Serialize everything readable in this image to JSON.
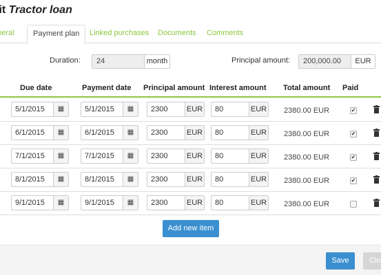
{
  "header": {
    "title_prefix": "lit ",
    "title_name": "Tractor loan"
  },
  "tabs": [
    {
      "label": "eneral",
      "active": false
    },
    {
      "label": "Payment plan",
      "active": true
    },
    {
      "label": "Linked purchases",
      "active": false
    },
    {
      "label": "Documents",
      "active": false
    },
    {
      "label": "Comments",
      "active": false
    }
  ],
  "summary": {
    "duration_label": "Duration:",
    "duration_value": "24",
    "duration_unit": "month",
    "principal_label": "Principal amount:",
    "principal_value": "200,000.00",
    "principal_currency": "EUR"
  },
  "table": {
    "columns": [
      "Due date",
      "Payment date",
      "Principal amount",
      "Interest amount",
      "Total amount",
      "Paid"
    ],
    "rows": [
      {
        "due_date": "5/1/2015",
        "payment_date": "5/1/2015",
        "principal": "2300",
        "principal_cur": "EUR",
        "interest": "80",
        "interest_cur": "EUR",
        "total": "2380.00 EUR",
        "paid_mark": "✔"
      },
      {
        "due_date": "6/1/2015",
        "payment_date": "6/1/2015",
        "principal": "2300",
        "principal_cur": "EUR",
        "interest": "80",
        "interest_cur": "EUR",
        "total": "2380.00 EUR",
        "paid_mark": "✔"
      },
      {
        "due_date": "7/1/2015",
        "payment_date": "7/1/2015",
        "principal": "2300",
        "principal_cur": "EUR",
        "interest": "80",
        "interest_cur": "EUR",
        "total": "2380.00 EUR",
        "paid_mark": "✔"
      },
      {
        "due_date": "8/1/2015",
        "payment_date": "8/1/2015",
        "principal": "2300",
        "principal_cur": "EUR",
        "interest": "80",
        "interest_cur": "EUR",
        "total": "2380.00 EUR",
        "paid_mark": "✔"
      },
      {
        "due_date": "9/1/2015",
        "payment_date": "9/1/2015",
        "principal": "2300",
        "principal_cur": "EUR",
        "interest": "80",
        "interest_cur": "EUR",
        "total": "2380.00 EUR",
        "paid_mark": ""
      }
    ]
  },
  "actions": {
    "add_label": "Add new item",
    "save_label": "Save",
    "close_label": "Clo"
  },
  "icons": {
    "calendar": "calendar-icon",
    "trash": "trash-icon",
    "check": "check-icon"
  },
  "colors": {
    "accent_green": "#8cc63f",
    "button_blue": "#3a8fd0",
    "disabled_gray": "#d5d5d5"
  }
}
